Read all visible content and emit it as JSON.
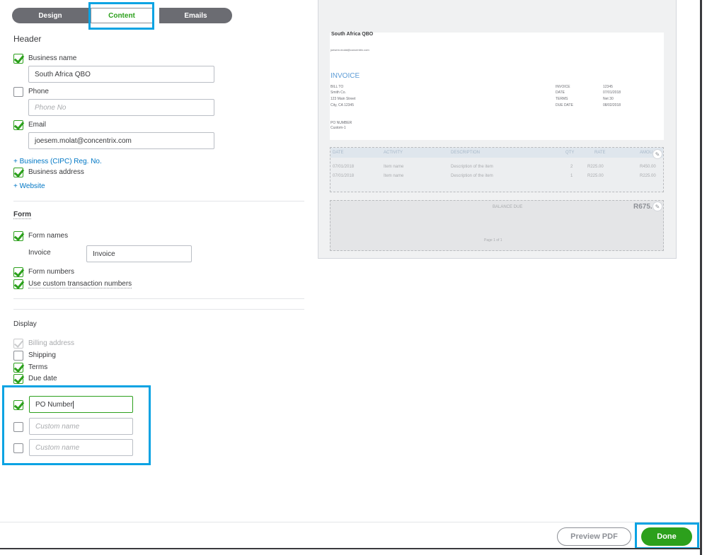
{
  "tabs": {
    "design": "Design",
    "content": "Content",
    "emails": "Emails"
  },
  "header": {
    "title": "Header",
    "business_name": {
      "label": "Business name",
      "checked": true,
      "value": "South Africa QBO"
    },
    "phone": {
      "label": "Phone",
      "checked": false,
      "placeholder": "Phone No"
    },
    "email": {
      "label": "Email",
      "checked": true,
      "value": "joesem.molat@concentrix.com"
    },
    "reg_no_link": "+ Business (CIPC) Reg. No.",
    "business_address": {
      "label": "Business address",
      "checked": true
    },
    "website_link": "+ Website"
  },
  "form": {
    "title": "Form",
    "form_names": {
      "label": "Form names",
      "checked": true
    },
    "invoice_label": "Invoice",
    "invoice_value": "Invoice",
    "form_numbers": {
      "label": "Form numbers",
      "checked": true
    },
    "custom_numbers": {
      "label": "Use custom transaction numbers",
      "checked": true
    }
  },
  "display": {
    "title": "Display",
    "billing_address": {
      "label": "Billing address",
      "checked": true,
      "disabled": true
    },
    "shipping": {
      "label": "Shipping",
      "checked": false
    },
    "terms": {
      "label": "Terms",
      "checked": true
    },
    "due_date": {
      "label": "Due date",
      "checked": true
    },
    "custom_fields": [
      {
        "checked": true,
        "value": "PO Number",
        "placeholder": "Custom name"
      },
      {
        "checked": false,
        "value": "",
        "placeholder": "Custom name"
      },
      {
        "checked": false,
        "value": "",
        "placeholder": "Custom name"
      }
    ]
  },
  "preview": {
    "company": "South Africa QBO",
    "email": "joesem.molat@concentrix.com",
    "invoice_title": "INVOICE",
    "bill_to_label": "BILL TO",
    "bill_to_lines": [
      "Smith Co.",
      "123 Main Street",
      "City, CA 12345"
    ],
    "meta_labels": [
      "INVOICE",
      "DATE",
      "TERMS",
      "DUE DATE"
    ],
    "meta_values": [
      "12345",
      "07/01/2018",
      "Net 30",
      "08/02/2018"
    ],
    "po_label": "PO NUMBER",
    "po_value": "Custom-1",
    "table_headers": [
      "DATE",
      "ACTIVITY",
      "DESCRIPTION",
      "QTY",
      "RATE",
      "AMOU"
    ],
    "rows": [
      [
        "07/01/2018",
        "Item name",
        "Description of the item",
        "2",
        "R225.00",
        "R450.00"
      ],
      [
        "07/01/2018",
        "Item name",
        "Description of the item",
        "1",
        "R225.00",
        "R225.00"
      ]
    ],
    "balance_due_label": "BALANCE DUE",
    "balance_due_value": "R675.",
    "page_label": "Page 1 of 1"
  },
  "footer": {
    "preview_pdf": "Preview PDF",
    "done": "Done"
  },
  "colors": {
    "accent_green": "#2ca01c",
    "highlight_blue": "#0aa3e3",
    "link_blue": "#0077c5"
  }
}
